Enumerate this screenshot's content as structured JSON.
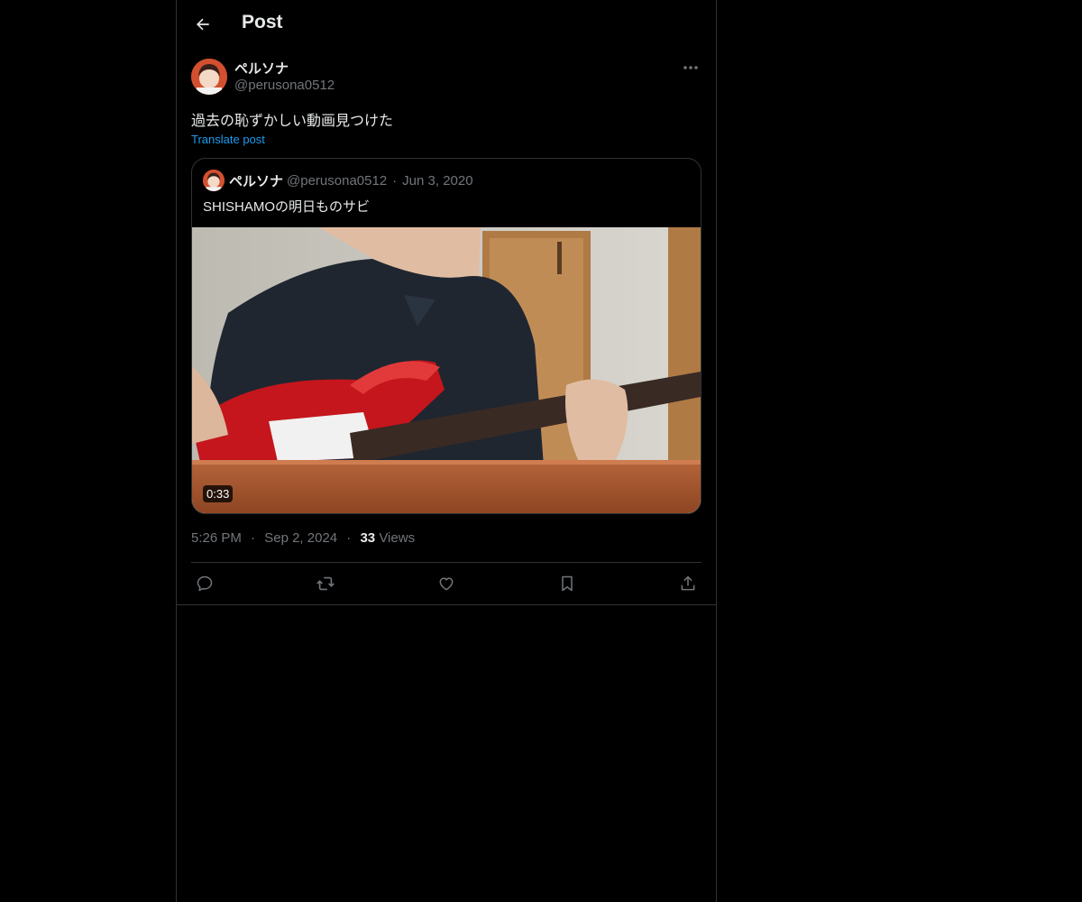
{
  "header": {
    "title": "Post"
  },
  "post": {
    "author_name": "ペルソナ",
    "author_handle": "@perusona0512",
    "text": "過去の恥ずかしい動画見つけた",
    "translate_label": "Translate post",
    "time": "5:26 PM",
    "date": "Sep 2, 2024",
    "views_count": "33",
    "views_label": "Views",
    "separator": "·"
  },
  "quote": {
    "author_name": "ペルソナ",
    "author_handle": "@perusona0512",
    "date": "Jun 3, 2020",
    "text": "SHISHAMOの明日ものサビ",
    "video_duration": "0:33"
  },
  "actions": [
    "reply-icon",
    "repost-icon",
    "like-icon",
    "bookmark-icon",
    "share-icon"
  ],
  "colors": {
    "background": "#000000",
    "text_primary": "#e7e9ea",
    "text_secondary": "#71767b",
    "link": "#1d9bf0",
    "border": "#2f3336"
  }
}
